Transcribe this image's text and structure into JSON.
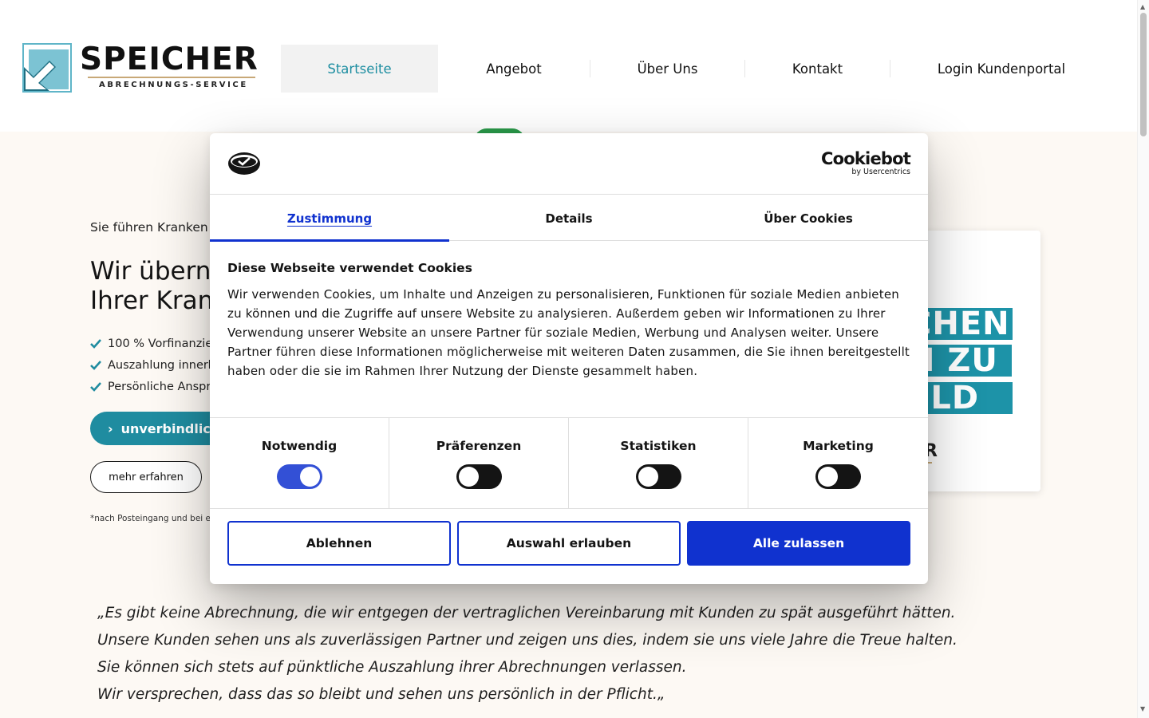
{
  "header": {
    "logo": {
      "wordmark": "SPEICHER",
      "tagline": "ABRECHNUNGS-SERVICE"
    },
    "nav": [
      {
        "label": "Startseite",
        "active": true
      },
      {
        "label": "Angebot",
        "active": false
      },
      {
        "label": "Über Uns",
        "active": false
      },
      {
        "label": "Kontakt",
        "active": false
      },
      {
        "label": "Login Kundenportal",
        "active": false
      }
    ]
  },
  "hero": {
    "kicker": "Sie führen Kranken",
    "title_line1": "Wir übern",
    "title_line2": "Ihrer Kran",
    "checks": [
      "100 % Vorfinanzier",
      "Auszahlung innerh",
      "Persönliche Anspr"
    ],
    "cta_primary": "unverbindlich",
    "cta_secondary": "mehr erfahren",
    "footnote": "*nach Posteingang und bei e",
    "promo": {
      "band1": "CHEN",
      "band2": "N ZU",
      "band3": "ELD",
      "logo_fragment": "R"
    }
  },
  "quote": {
    "lines": [
      "„Es gibt keine Abrechnung, die wir entgegen der vertraglichen Vereinbarung mit Kunden zu spät ausgeführt hätten.",
      "Unsere Kunden sehen uns als zuverlässigen Partner und zeigen uns dies, indem sie uns viele Jahre die Treue halten.",
      "Sie können sich stets auf pünktliche Auszahlung ihrer Abrechnungen verlassen.",
      "Wir versprechen, dass das so bleibt und sehen uns persönlich in der Pflicht.„"
    ]
  },
  "cookie_dialog": {
    "brand": "Cookiebot",
    "brand_sub": "by Usercentrics",
    "tabs": [
      {
        "label": "Zustimmung",
        "active": true
      },
      {
        "label": "Details",
        "active": false
      },
      {
        "label": "Über Cookies",
        "active": false
      }
    ],
    "title": "Diese Webseite verwendet Cookies",
    "text": "Wir verwenden Cookies, um Inhalte und Anzeigen zu personalisieren, Funktionen für soziale Medien anbieten zu können und die Zugriffe auf unsere Website zu analysieren. Außerdem geben wir Informationen zu Ihrer Verwendung unserer Website an unsere Partner für soziale Medien, Werbung und Analysen weiter. Unsere Partner führen diese Informationen möglicherweise mit weiteren Daten zusammen, die Sie ihnen bereitgestellt haben oder die sie im Rahmen Ihrer Nutzung der Dienste gesammelt haben.",
    "consents": [
      {
        "label": "Notwendig",
        "checked": true
      },
      {
        "label": "Präferenzen",
        "checked": false
      },
      {
        "label": "Statistiken",
        "checked": false
      },
      {
        "label": "Marketing",
        "checked": false
      }
    ],
    "buttons": {
      "decline": "Ablehnen",
      "allow_selection": "Auswahl erlauben",
      "allow_all": "Alle zulassen"
    }
  },
  "colors": {
    "accent_teal": "#1f8ca0",
    "cookie_blue": "#1032cf",
    "hero_bg": "#fdf9f4"
  },
  "icons": {
    "check": "check-icon",
    "chevron": "chevron-right-icon",
    "logo_mark": "arrow-box-logo-icon"
  }
}
